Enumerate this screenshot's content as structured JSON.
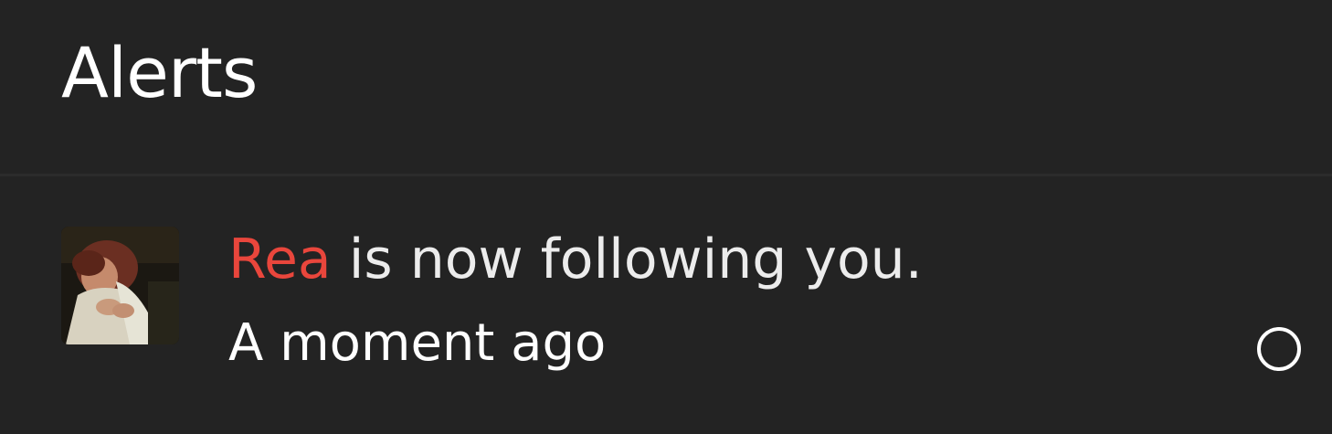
{
  "header": {
    "title": "Alerts"
  },
  "alerts": [
    {
      "actor": "Rea",
      "message": " is now following you.",
      "time": "A moment ago",
      "read": false,
      "actor_color": "#e9463c",
      "avatar": "user-avatar-photo"
    }
  ],
  "colors": {
    "background": "#232323",
    "divider": "#2b2b2b",
    "text": "#ffffff",
    "accent": "#e9463c"
  },
  "icons": {
    "read_toggle": "unread-circle-icon"
  }
}
